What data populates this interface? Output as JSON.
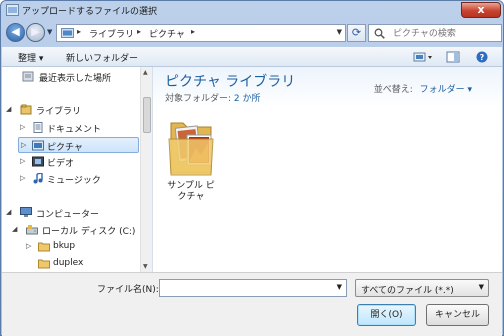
{
  "window": {
    "title": "アップロードするファイルの選択",
    "close_glyph": "x"
  },
  "nav": {
    "address_segments": [
      "ライブラリ",
      "ピクチャ"
    ],
    "search_placeholder": "ピクチャの検索"
  },
  "toolbar": {
    "organize_label": "整理 ▾",
    "new_folder_label": "新しいフォルダー"
  },
  "sidebar": {
    "items": [
      {
        "label": "最近表示した場所"
      },
      {
        "label": "ライブラリ"
      },
      {
        "label": "ドキュメント"
      },
      {
        "label": "ピクチャ"
      },
      {
        "label": "ビデオ"
      },
      {
        "label": "ミュージック"
      },
      {
        "label": "コンピューター"
      },
      {
        "label": "ローカル ディスク (C:)"
      },
      {
        "label": "bkup"
      },
      {
        "label": "duplex"
      }
    ]
  },
  "library": {
    "title": "ピクチャ ライブラリ",
    "subtitle_prefix": "対象フォルダー:",
    "subtitle_link": "2 か所",
    "arrange_label": "並べ替え:",
    "arrange_value": "フォルダー ▾",
    "items": [
      {
        "label": "サンプル ピクチャ"
      }
    ]
  },
  "footer": {
    "filename_label": "ファイル名(N):",
    "filename_value": "",
    "filter_value": "すべてのファイル (*.*)",
    "open_label": "開く(O)",
    "cancel_label": "キャンセル"
  },
  "colors": {
    "accent": "#1e5fa0",
    "title_bar": "#bcd0ea",
    "close_button": "#c8442f"
  }
}
